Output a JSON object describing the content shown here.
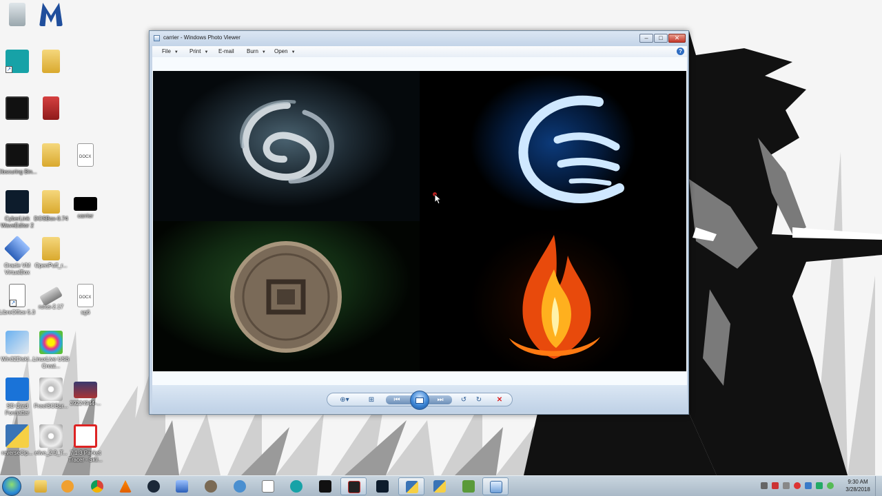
{
  "desktop": {
    "icons": [
      {
        "name": "recycle-bin-icon",
        "label": ""
      },
      {
        "name": "malwarebytes-icon",
        "label": ""
      },
      {
        "name": "arduino-icon",
        "label": ""
      },
      {
        "name": "arduino-folder-icon",
        "label": ""
      },
      {
        "name": "screen-recorder-icon",
        "label": ""
      },
      {
        "name": "red-archive-icon",
        "label": ""
      },
      {
        "name": "obs-studio-icon",
        "label": "Obscuring Bin..."
      },
      {
        "name": "folder-icon",
        "label": ""
      },
      {
        "name": "docx-file-icon",
        "label": ""
      },
      {
        "name": "cyberlink-wave-editor-icon",
        "label": "CyberLink WaveEditor 2"
      },
      {
        "name": "dosbox-folder-icon",
        "label": "DOSBox-0.74"
      },
      {
        "name": "carrier-image-icon",
        "label": "carrier"
      },
      {
        "name": "oracle-vm-virtualbox-icon",
        "label": "Oracle VM VirtualBox"
      },
      {
        "name": "openpuff-folder-icon",
        "label": "OpenPuff_r..."
      },
      {
        "name": "libreoffice-icon",
        "label": "LibreOffice 5.3"
      },
      {
        "name": "rufus-icon",
        "label": "rufus-2.17"
      },
      {
        "name": "sg6-docx-icon",
        "label": "sg6"
      },
      {
        "name": "win32diskimager-icon",
        "label": "Win32DiskI..."
      },
      {
        "name": "linuxlive-usb-creator-icon",
        "label": "LinuxLive USB Creat..."
      },
      {
        "name": "sd-card-formatter-icon",
        "label": "SD Card Formatter"
      },
      {
        "name": "freeisoburner-icon",
        "label": "FreeISOBur..."
      },
      {
        "name": "image-39224944-icon",
        "label": "39224944-..."
      },
      {
        "name": "reversecipher-python-icon",
        "label": "reverseCip..."
      },
      {
        "name": "elive-iso-icon",
        "label": "elive_2.9_T..."
      },
      {
        "name": "packet-tracer-icon",
        "label": "7.1.3 Packet Tracer - Skil..."
      }
    ]
  },
  "viewer": {
    "title": "carrier - Windows Photo Viewer",
    "window_buttons": {
      "minimize": "–",
      "maximize": "□",
      "close": "✕"
    },
    "menu": [
      {
        "label": "File"
      },
      {
        "label": "Print"
      },
      {
        "label": "E-mail"
      },
      {
        "label": "Burn"
      },
      {
        "label": "Open"
      }
    ],
    "help": "?",
    "image_name": "carrier",
    "controls": {
      "zoom": "zoom-icon",
      "actual_size": "fit-window-icon",
      "previous": "previous-icon",
      "slideshow": "slideshow-icon",
      "next": "next-icon",
      "rotate_ccw": "rotate-counterclockwise-icon",
      "rotate_cw": "rotate-clockwise-icon",
      "delete": "delete-icon"
    }
  },
  "taskbar": {
    "pinned": [
      {
        "name": "taskbar-explorer-icon"
      },
      {
        "name": "taskbar-media-player-icon"
      },
      {
        "name": "taskbar-chrome-icon"
      },
      {
        "name": "taskbar-vlc-icon"
      },
      {
        "name": "taskbar-steam-icon"
      },
      {
        "name": "taskbar-virtualbox-icon"
      },
      {
        "name": "taskbar-gimp-icon"
      },
      {
        "name": "taskbar-app-icon"
      },
      {
        "name": "taskbar-notepad-icon"
      },
      {
        "name": "taskbar-arduino-icon"
      },
      {
        "name": "taskbar-screen-recorder-icon"
      },
      {
        "name": "taskbar-recorder-icon"
      },
      {
        "name": "taskbar-waveeditor-icon"
      },
      {
        "name": "taskbar-python-icon"
      },
      {
        "name": "taskbar-python-idle-icon"
      },
      {
        "name": "taskbar-packet-tracer-icon"
      },
      {
        "name": "taskbar-photo-viewer-icon"
      }
    ],
    "clock": {
      "time": "9:30 AM",
      "date": "3/28/2018"
    }
  }
}
